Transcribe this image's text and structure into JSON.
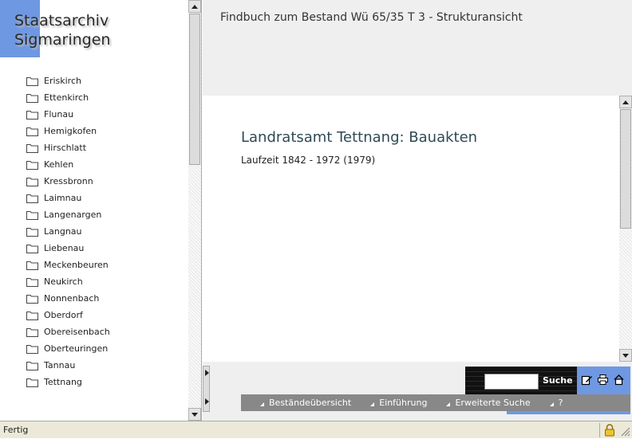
{
  "logo": {
    "line1": "Staatsarchiv",
    "line2": "Sigmaringen",
    "accent": "#6f98e2"
  },
  "tree": {
    "items": [
      {
        "label": "Eriskirch"
      },
      {
        "label": "Ettenkirch"
      },
      {
        "label": "Flunau"
      },
      {
        "label": "Hemigkofen"
      },
      {
        "label": "Hirschlatt"
      },
      {
        "label": "Kehlen"
      },
      {
        "label": "Kressbronn"
      },
      {
        "label": "Laimnau"
      },
      {
        "label": "Langenargen"
      },
      {
        "label": "Langnau"
      },
      {
        "label": "Liebenau"
      },
      {
        "label": "Meckenbeuren"
      },
      {
        "label": "Neukirch"
      },
      {
        "label": "Nonnenbach"
      },
      {
        "label": "Oberdorf"
      },
      {
        "label": "Obereisenbach"
      },
      {
        "label": "Oberteuringen"
      },
      {
        "label": "Tannau"
      },
      {
        "label": "Tettnang"
      }
    ],
    "icon": "folder-icon"
  },
  "header": {
    "title": "Findbuch zum Bestand Wü 65/35 T 3 - Strukturansicht"
  },
  "content": {
    "title": "Landratsamt Tettnang: Bauakten",
    "laufzeit": "Laufzeit 1842 - 1972 (1979)",
    "title_color": "#2e4a55"
  },
  "search": {
    "value": "",
    "button_label": "Suche"
  },
  "toolbar_icons": [
    "edit-icon",
    "print-icon",
    "home-icon"
  ],
  "nav": {
    "items": [
      {
        "label": "Beständeübersicht"
      },
      {
        "label": "Einführung"
      },
      {
        "label": "Erweiterte Suche"
      },
      {
        "label": "?"
      }
    ]
  },
  "status": {
    "text": "Fertig"
  }
}
